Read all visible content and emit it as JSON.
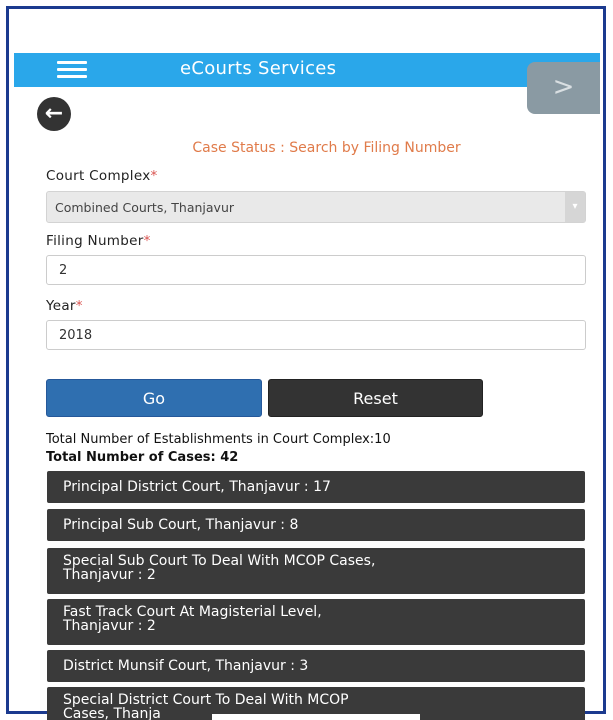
{
  "app": {
    "title": "eCourts Services",
    "next_glyph": ">",
    "back_glyph": "←"
  },
  "page": {
    "heading": "Case Status : Search by Filing Number"
  },
  "form": {
    "court_complex": {
      "label": "Court Complex",
      "required_mark": "*",
      "value": "Combined Courts, Thanjavur",
      "arrow": "▾"
    },
    "filing_number": {
      "label": "Filing Number",
      "required_mark": "*",
      "value": "2"
    },
    "year": {
      "label": "Year",
      "required_mark": "*",
      "value": "2018"
    },
    "go_label": "Go",
    "reset_label": "Reset"
  },
  "results": {
    "establishments_text": "Total Number of Establishments in Court Complex:10",
    "cases_text": "Total Number of Cases: 42",
    "courts": [
      {
        "line1": "Principal District Court, Thanjavur : 17",
        "line2": ""
      },
      {
        "line1": "Principal Sub Court, Thanjavur : 8",
        "line2": ""
      },
      {
        "line1": "Special Sub Court To Deal With MCOP Cases,",
        "line2": "Thanjavur : 2"
      },
      {
        "line1": "Fast Track Court At Magisterial Level,",
        "line2": "Thanjavur : 2"
      },
      {
        "line1": "District Munsif Court, Thanjavur : 3",
        "line2": ""
      },
      {
        "line1": "Special District Court To Deal With MCOP",
        "line2": "Cases, Thanja"
      }
    ]
  },
  "colors": {
    "topbar": "#2aa7ea",
    "heading": "#e07b4a",
    "go": "#2f6fb0",
    "reset": "#333333",
    "list_item": "#3a3a3a",
    "frame": "#1b3a8f"
  }
}
